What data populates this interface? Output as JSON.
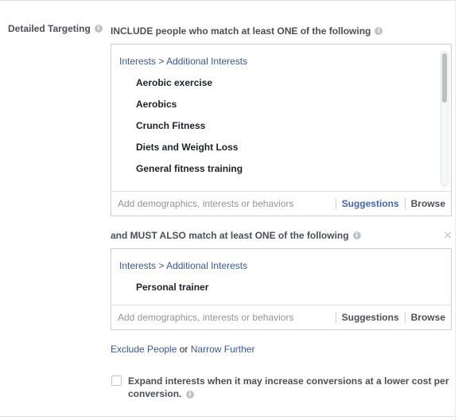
{
  "section": {
    "label": "Detailed Targeting",
    "info_icon": "info-icon"
  },
  "include_group": {
    "heading": "INCLUDE people who match at least ONE of the following",
    "breadcrumb_root": "Interests",
    "breadcrumb_sep": ">",
    "breadcrumb_child": "Additional Interests",
    "items": [
      "Aerobic exercise",
      "Aerobics",
      "Crunch Fitness",
      "Diets and Weight Loss",
      "General fitness training"
    ],
    "search_placeholder": "Add demographics, interests or behaviors",
    "suggestions_label": "Suggestions",
    "browse_label": "Browse"
  },
  "narrow_group": {
    "heading": "and MUST ALSO match at least ONE of the following",
    "breadcrumb_root": "Interests",
    "breadcrumb_sep": ">",
    "breadcrumb_child": "Additional Interests",
    "items": [
      "Personal trainer"
    ],
    "search_placeholder": "Add demographics, interests or behaviors",
    "suggestions_label": "Suggestions",
    "browse_label": "Browse",
    "remove_label": "×"
  },
  "footer": {
    "exclude_label": "Exclude People",
    "or_text": "or",
    "narrow_label": "Narrow Further"
  },
  "expand": {
    "label": "Expand interests when it may increase conversions at a lower cost per conversion.",
    "checked": false
  },
  "colors": {
    "link": "#365899",
    "active": "#4267b2",
    "border": "#ccd0d5"
  }
}
